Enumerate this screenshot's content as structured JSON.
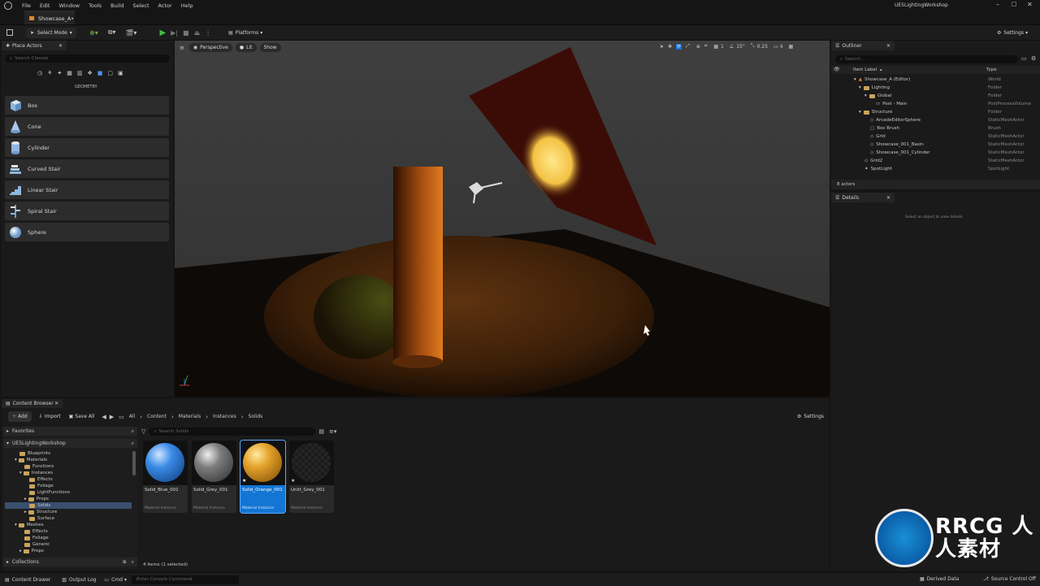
{
  "menu": [
    "File",
    "Edit",
    "Window",
    "Tools",
    "Build",
    "Select",
    "Actor",
    "Help"
  ],
  "project_name": "UE5LightingWorkshop",
  "level_tab": "Showcase_A•",
  "toolbar": {
    "select_mode": "Select Mode",
    "platforms": "Platforms",
    "settings": "Settings"
  },
  "place_actors": {
    "tab": "Place Actors",
    "search_placeholder": "Search Classes",
    "category": "GEOMETRY",
    "items": [
      {
        "label": "Box",
        "icon": "box-icon"
      },
      {
        "label": "Cone",
        "icon": "cone-icon"
      },
      {
        "label": "Cylinder",
        "icon": "cylinder-icon"
      },
      {
        "label": "Curved Stair",
        "icon": "curved-stair-icon"
      },
      {
        "label": "Linear Stair",
        "icon": "linear-stair-icon"
      },
      {
        "label": "Spiral Stair",
        "icon": "spiral-stair-icon"
      },
      {
        "label": "Sphere",
        "icon": "sphere-icon"
      }
    ]
  },
  "viewport": {
    "perspective": "Perspective",
    "lit": "Lit",
    "show": "Show",
    "grid_snap": "1",
    "rotation_snap": "15°",
    "scale_snap": "0.25",
    "camera_speed": "4"
  },
  "outliner": {
    "tab": "Outliner",
    "search_placeholder": "Search...",
    "col_label": "Item Label",
    "col_type": "Type",
    "rows": [
      {
        "label": "Showcase_A (Editor)",
        "type": "World"
      },
      {
        "label": "Lighting",
        "type": "Folder"
      },
      {
        "label": "Global",
        "type": "Folder"
      },
      {
        "label": "Post - Main",
        "type": "PostProcessVolume"
      },
      {
        "label": "Structure",
        "type": "Folder"
      },
      {
        "label": "ArcadeEditorSphere",
        "type": "StaticMeshActor"
      },
      {
        "label": "Box Brush",
        "type": "Brush"
      },
      {
        "label": "Grid",
        "type": "StaticMeshActor"
      },
      {
        "label": "Showcase_001_Basin",
        "type": "StaticMeshActor"
      },
      {
        "label": "Showcase_001_Cylinder",
        "type": "StaticMeshActor"
      },
      {
        "label": "Grid2",
        "type": "StaticMeshActor"
      },
      {
        "label": "SpotLight",
        "type": "SpotLight"
      }
    ],
    "actor_count": "8 actors"
  },
  "details": {
    "tab": "Details",
    "empty_msg": "Select an object to view details."
  },
  "content_browser": {
    "tab": "Content Browser",
    "add": "Add",
    "import": "Import",
    "save_all": "Save All",
    "breadcrumb": [
      "All",
      "Content",
      "Materials",
      "Instances",
      "Solids"
    ],
    "settings": "Settings",
    "favorites": "Favorites",
    "project": "UE5LightingWorkshop",
    "search_placeholder": "Search Solids",
    "tree": [
      "Blueprints",
      "Materials",
      "Functions",
      "Instances",
      "Effects",
      "Foliage",
      "LightFunctions",
      "Props",
      "Solids",
      "Structure",
      "Surface",
      "Meshes",
      "Effects",
      "Foliage",
      "Generic",
      "Props"
    ],
    "collections": "Collections",
    "assets": [
      {
        "name": "Solid_Blue_001",
        "type": "Material Instance"
      },
      {
        "name": "Solid_Grey_001",
        "type": "Material Instance"
      },
      {
        "name": "Solid_Orange_001",
        "type": "Material Instance"
      },
      {
        "name": "Unlit_Grey_001",
        "type": "Material Instance"
      }
    ],
    "item_count": "4 items (1 selected)"
  },
  "statusbar": {
    "content_drawer": "Content Drawer",
    "output_log": "Output Log",
    "cmd": "Cmd",
    "console_placeholder": "Enter Console Command",
    "derived_data": "Derived Data",
    "source_control": "Source Control Off"
  },
  "watermark": "RRCG 人人素材"
}
